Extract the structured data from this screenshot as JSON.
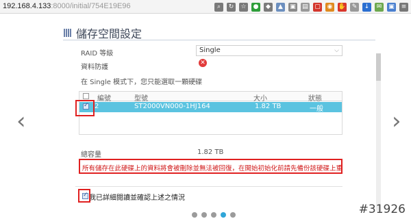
{
  "browser": {
    "url_host": "192.168.4.133",
    "url_rest": ":8000/initial/754E19E96",
    "extensions": [
      {
        "icon": "search-icon",
        "color": "#7a7a7a",
        "glyph": "⌕"
      },
      {
        "icon": "reload-icon",
        "color": "#7a7a7a",
        "glyph": "↻"
      },
      {
        "icon": "star-icon",
        "color": "#7a7a7a",
        "glyph": "☆"
      },
      {
        "icon": "gem-icon",
        "color": "#2e9e3a",
        "glyph": "●"
      },
      {
        "icon": "shield-icon",
        "color": "#7b7b7b",
        "glyph": "◆"
      },
      {
        "icon": "puzzle-icon",
        "color": "#6c8fbf",
        "glyph": "▲"
      },
      {
        "icon": "android-icon",
        "color": "#8a8a8a",
        "glyph": "▣"
      },
      {
        "icon": "lock-icon",
        "color": "#999999",
        "glyph": "▤"
      },
      {
        "icon": "note-icon",
        "color": "#d3362c",
        "glyph": "▢"
      },
      {
        "icon": "camera-icon",
        "color": "#e08a1e",
        "glyph": "◉"
      },
      {
        "icon": "adblock-icon",
        "color": "#d9362b",
        "glyph": "✋"
      },
      {
        "icon": "wrench-icon",
        "color": "#999999",
        "glyph": "✎"
      },
      {
        "icon": "download-icon",
        "color": "#2b6fd1",
        "glyph": "↓"
      },
      {
        "icon": "email-icon",
        "color": "#6da84e",
        "glyph": "✉"
      },
      {
        "icon": "bookmark-icon",
        "color": "#4a7fcf",
        "glyph": "▣"
      },
      {
        "icon": "menu-icon",
        "color": "#777777",
        "glyph": "≡"
      }
    ]
  },
  "page": {
    "title": "儲存空間設定",
    "raid_label": "RAID 等級",
    "raid_value": "Single",
    "protection_label": "資料防護",
    "mode_hint": "在 Single 模式下，您只能選取一顆硬碟"
  },
  "table": {
    "headers": {
      "number": "編號",
      "model": "型號",
      "size": "大小",
      "status": "狀態"
    },
    "rows": [
      {
        "number": "2",
        "model": "ST2000VN000-1HJ164",
        "size": "1.82 TB",
        "status": "一般",
        "checked": true
      }
    ]
  },
  "summary": {
    "total_label": "總容量",
    "total_value": "1.82 TB"
  },
  "warning": "所有儲存在此硬碟上的資料將會被刪除並無法被回復，在開始初始化前請先備份該硬碟上重要的資料",
  "confirm_label": "我已詳細閱讀並確認上述之情況",
  "pager": {
    "count": 5,
    "active_index": 3
  },
  "watermark": "#31926"
}
